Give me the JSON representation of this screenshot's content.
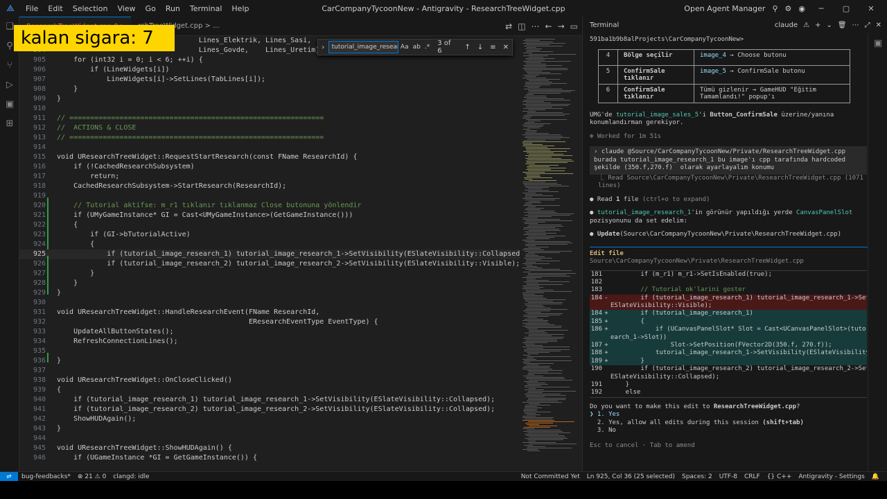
{
  "window": {
    "title": "CarCompanyTycoonNew - Antigravity - ResearchTreeWidget.cpp",
    "menu": [
      "File",
      "Edit",
      "Selection",
      "View",
      "Go",
      "Run",
      "Terminal",
      "Help"
    ],
    "agent_manager": "Open Agent Manager"
  },
  "overlay": {
    "label": "kalan sigara: 7"
  },
  "editor": {
    "tab_label": "ResearchTreeWidget.cpp 9+",
    "breadcrumb": "rchTreeWidget.cpp > ...",
    "find": {
      "value": "tutorial_image_research_1",
      "count": "3 of 6",
      "opt_case": "Aa",
      "opt_word": "ab",
      "opt_regex": ".*"
    },
    "lines": [
      {
        "n": "903",
        "code": "                                  Lines_Elektrik, Lines_Sasi,"
      },
      {
        "n": "904",
        "code": "                                  Lines_Govde,    Lines_Uretim};"
      },
      {
        "n": "905",
        "code": "    for (int32 i = 0; i < 6; ++i) {"
      },
      {
        "n": "906",
        "code": "        if (LineWidgets[i])"
      },
      {
        "n": "907",
        "code": "            LineWidgets[i]->SetLines(TabLines[i]);"
      },
      {
        "n": "908",
        "code": "    }"
      },
      {
        "n": "909",
        "code": "}"
      },
      {
        "n": "910",
        "code": ""
      },
      {
        "n": "911",
        "code": "// ============================================================="
      },
      {
        "n": "912",
        "code": "//  ACTIONS & CLOSE"
      },
      {
        "n": "913",
        "code": "// ============================================================="
      },
      {
        "n": "914",
        "code": ""
      },
      {
        "n": "915",
        "code": "void UResearchTreeWidget::RequestStartResearch(const FName ResearchId) {"
      },
      {
        "n": "916",
        "code": "    if (!CachedResearchSubsystem)"
      },
      {
        "n": "917",
        "code": "        return;"
      },
      {
        "n": "918",
        "code": "    CachedResearchSubsystem->StartResearch(ResearchId);"
      },
      {
        "n": "919",
        "code": ""
      },
      {
        "n": "920",
        "code": "    // Tutorial aktifse: m_r1 tıklanır tıklanmaz Close butonuna yönlendir"
      },
      {
        "n": "921",
        "code": "    if (UMyGameInstance* GI = Cast<UMyGameInstance>(GetGameInstance()))"
      },
      {
        "n": "922",
        "code": "    {"
      },
      {
        "n": "923",
        "code": "        if (GI->bTutorialActive)"
      },
      {
        "n": "924",
        "code": "        {"
      },
      {
        "n": "925",
        "code": "            if (tutorial_image_research_1) tutorial_image_research_1->SetVisibility(ESlateVisibility::Collapsed);"
      },
      {
        "n": "926",
        "code": "            if (tutorial_image_research_2) tutorial_image_research_2->SetVisibility(ESlateVisibility::Visible);"
      },
      {
        "n": "927",
        "code": "        }"
      },
      {
        "n": "928",
        "code": "    }"
      },
      {
        "n": "929",
        "code": "}"
      },
      {
        "n": "930",
        "code": ""
      },
      {
        "n": "931",
        "code": "void UResearchTreeWidget::HandleResearchEvent(FName ResearchId,"
      },
      {
        "n": "932",
        "code": "                                              EResearchEventType EventType) {"
      },
      {
        "n": "933",
        "code": "    UpdateAllButtonStates();"
      },
      {
        "n": "934",
        "code": "    RefreshConnectionLines();"
      },
      {
        "n": "935",
        "code": ""
      },
      {
        "n": "936",
        "code": "}"
      },
      {
        "n": "937",
        "code": ""
      },
      {
        "n": "938",
        "code": "void UResearchTreeWidget::OnCloseClicked()"
      },
      {
        "n": "939",
        "code": "{"
      },
      {
        "n": "940",
        "code": "    if (tutorial_image_research_1) tutorial_image_research_1->SetVisibility(ESlateVisibility::Collapsed);"
      },
      {
        "n": "941",
        "code": "    if (tutorial_image_research_2) tutorial_image_research_2->SetVisibility(ESlateVisibility::Collapsed);"
      },
      {
        "n": "942",
        "code": "    ShowHUDAgain();"
      },
      {
        "n": "943",
        "code": "}"
      },
      {
        "n": "944",
        "code": ""
      },
      {
        "n": "945",
        "code": "void UResearchTreeWidget::ShowHUDAgain() {"
      },
      {
        "n": "946",
        "code": "    if (UGameInstance *GI = GetGameInstance()) {"
      }
    ]
  },
  "terminal": {
    "title": "Terminal",
    "session": "claude",
    "path": "591ba1b9b8alProjects\\CarCompanyTycoonNew>",
    "table": [
      {
        "num": "4",
        "step": "Bölge seçilir",
        "result_img": "image_4",
        "result": " → Choose butonu"
      },
      {
        "num": "5",
        "step": "ConfirmSale tıklanır",
        "result_img": "image_5",
        "result": " → ConfirmSale butonu"
      },
      {
        "num": "6",
        "step": "ConfirmSale tıklanır",
        "result_img": "",
        "result": "Tümü gizlenir → GameHUD \"Eğitim Tamamlandı!\" popup'ı"
      }
    ],
    "umg_note_a": "UMG'de ",
    "umg_note_img": "tutorial_image_sales_5",
    "umg_note_b": "'i ",
    "umg_note_btn": "Button_ConfirmSale",
    "umg_note_c": " üzerine/yanına konumlandırman gerekiyor.",
    "worked": "✻ Worked for 1m 51s",
    "prompt": "claude @Source/CarCompanyTycoonNew/Private/ResearchTreeWidget.cpp burada tutorial_image_research_1 bu image'ı cpp tarafında hardcoded şekilde (350.f,270.f)  olarak ayarlayalım konumu",
    "read_result": "⎿ Read Source\\CarCompanyTycoonNew\\Private\\ResearchTreeWidget.cpp (1071 lines)",
    "read_file_a": "Read ",
    "read_file_b": "1",
    "read_file_c": " file ",
    "read_file_hint": "(ctrl+o to expand)",
    "msg_img": "tutorial_image_research_1",
    "msg_a": "'in görünür yapıldığı yerde ",
    "msg_slot": "CanvasPanelSlot",
    "msg_b": " pozisyonunu da set edelim:",
    "update_a": "Update",
    "update_b": "(Source\\CarCompanyTycoonNew\\Private\\ResearchTreeWidget.cpp)",
    "edit_title": "Edit file",
    "edit_path": "Source\\CarCompanyTycoonNew\\Private\\ResearchTreeWidget.cpp",
    "diff": [
      {
        "n": "181",
        "s": "",
        "k": "ctx",
        "code": "        if (m_r1) m_r1->SetIsEnabled(true);"
      },
      {
        "n": "182",
        "s": "",
        "k": "ctx",
        "code": ""
      },
      {
        "n": "183",
        "s": "",
        "k": "ctx",
        "code": "        // Tutorial ok'larini goster"
      },
      {
        "n": "184",
        "s": "-",
        "k": "del",
        "code": "        if (tutorial_image_research_1) tutorial_image_research_1->SetVisibility("
      },
      {
        "n": "",
        "s": "",
        "k": "del",
        "code": "ESlateVisibility::Visible);"
      },
      {
        "n": "184",
        "s": "+",
        "k": "add",
        "code": "        if (tutorial_image_research_1)"
      },
      {
        "n": "185",
        "s": "+",
        "k": "add",
        "code": "        {"
      },
      {
        "n": "186",
        "s": "+",
        "k": "add",
        "code": "            if (UCanvasPanelSlot* Slot = Cast<UCanvasPanelSlot>(tutorial_image_res"
      },
      {
        "n": "",
        "s": "",
        "k": "add",
        "code": "earch_1->Slot))"
      },
      {
        "n": "187",
        "s": "+",
        "k": "add",
        "code": "                Slot->SetPosition(FVector2D(350.f, 270.f));"
      },
      {
        "n": "188",
        "s": "+",
        "k": "add",
        "code": "            tutorial_image_research_1->SetVisibility(ESlateVisibility::Visible);"
      },
      {
        "n": "189",
        "s": "+",
        "k": "add",
        "code": "        }"
      },
      {
        "n": "190",
        "s": "",
        "k": "ctx",
        "code": "        if (tutorial_image_research_2) tutorial_image_research_2->SetVisibility("
      },
      {
        "n": "",
        "s": "",
        "k": "ctx",
        "code": "ESlateVisibility::Collapsed);"
      },
      {
        "n": "191",
        "s": "",
        "k": "ctx",
        "code": "    }"
      },
      {
        "n": "192",
        "s": "",
        "k": "ctx",
        "code": "    else"
      }
    ],
    "question_a": "Do you want to make this edit to ",
    "question_file": "ResearchTreeWidget.cpp",
    "question_b": "?",
    "options": [
      {
        "label": "❯ 1. Yes",
        "extra": ""
      },
      {
        "label": "  2. Yes, allow all edits during this session ",
        "extra": "(shift+tab)"
      },
      {
        "label": "  3. No",
        "extra": ""
      }
    ],
    "footer": "Esc to cancel · Tab to amend"
  },
  "statusbar": {
    "branch": "bug-feedbacks*",
    "errors": "⊗ 21 ⚠ 0",
    "clangd": "clangd: idle",
    "commit": "Not Committed Yet",
    "position": "Ln 925, Col 36 (25 selected)",
    "spaces": "Spaces: 2",
    "encoding": "UTF-8",
    "eol": "CRLF",
    "lang": "{} C++",
    "settings": "Antigravity - Settings"
  },
  "colors": {
    "accent": "#0078d4",
    "sticker": "#ffd500"
  }
}
